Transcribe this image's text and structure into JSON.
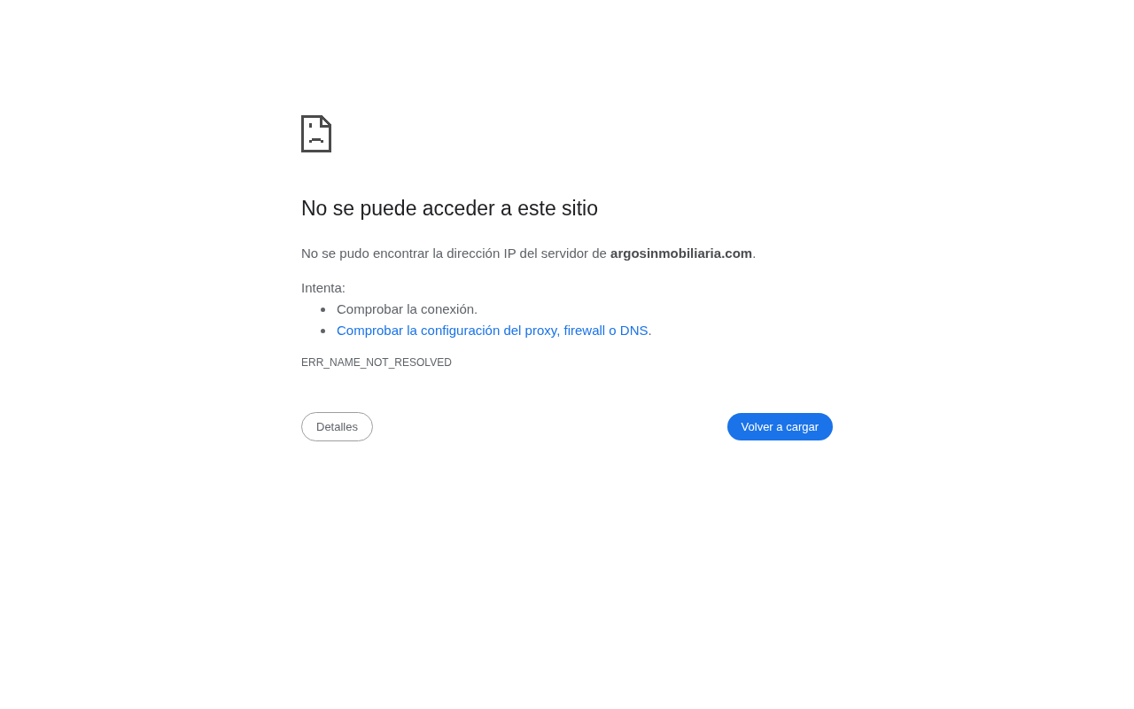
{
  "title": "No se puede acceder a este sitio",
  "message": "No se pudo encontrar la dirección IP del servidor de **argosinmobiliaria.com**.",
  "suggestions_heading": "Intenta:",
  "suggestions": [
    {
      "kind": "text",
      "text": "Comprobar la conexión."
    },
    {
      "kind": "link",
      "text": "Comprobar la configuración del proxy, firewall o DNS",
      "after": "."
    }
  ],
  "error_code": "ERR_NAME_NOT_RESOLVED",
  "buttons": {
    "details": "Detalles",
    "reload": "Volver a cargar"
  }
}
